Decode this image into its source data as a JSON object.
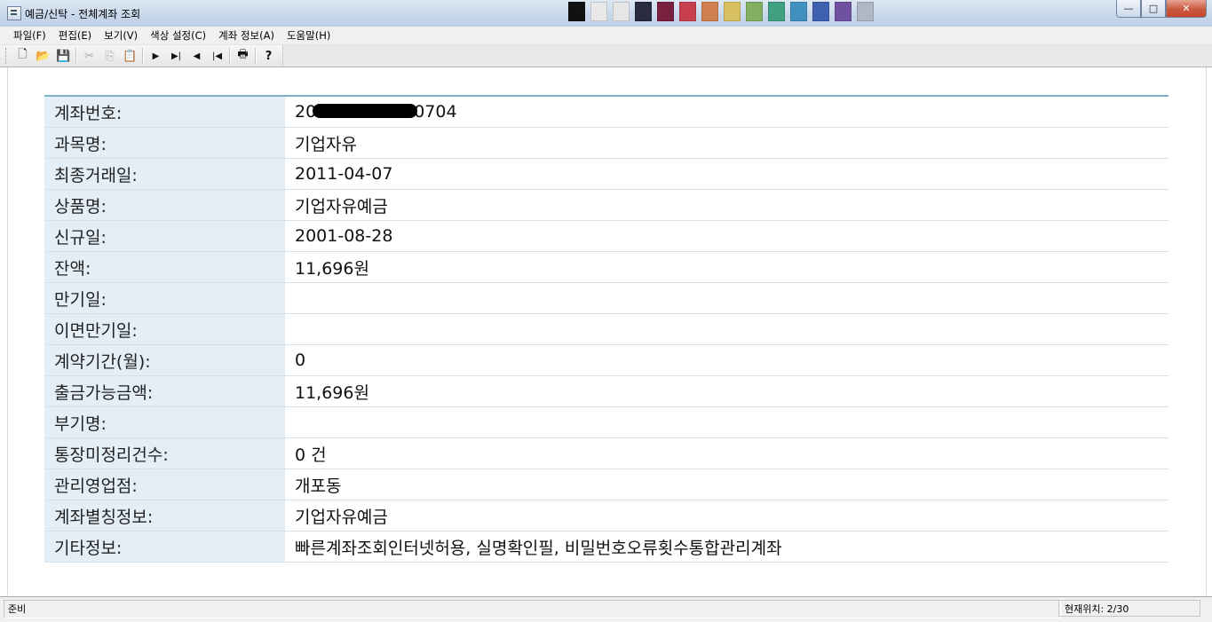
{
  "window": {
    "title": "예금/신탁 - 전체계좌 조회",
    "controls": {
      "minimize": "—",
      "maximize": "□",
      "close": "✕"
    }
  },
  "menu": [
    "파일(F)",
    "편집(E)",
    "보기(V)",
    "색상 설정(C)",
    "계좌 정보(A)",
    "도움말(H)"
  ],
  "toolbar": {
    "buttons": [
      {
        "name": "new-file-icon",
        "glyph": "🗋",
        "enabled": true
      },
      {
        "name": "open-folder-icon",
        "glyph": "📂",
        "enabled": true
      },
      {
        "name": "save-icon",
        "glyph": "💾",
        "enabled": true
      },
      {
        "name": "cut-icon",
        "glyph": "✂",
        "enabled": false
      },
      {
        "name": "copy-icon",
        "glyph": "⎘",
        "enabled": false
      },
      {
        "name": "paste-icon",
        "glyph": "📋",
        "enabled": false
      },
      {
        "name": "next-icon",
        "glyph": "▶",
        "enabled": true
      },
      {
        "name": "last-icon",
        "glyph": "▶|",
        "enabled": true
      },
      {
        "name": "previous-icon",
        "glyph": "◀",
        "enabled": true
      },
      {
        "name": "first-icon",
        "glyph": "|◀",
        "enabled": true
      },
      {
        "name": "print-icon",
        "glyph": "🖶",
        "enabled": true
      },
      {
        "name": "help-icon",
        "glyph": "?",
        "enabled": true
      }
    ]
  },
  "account": {
    "number_prefix": "20",
    "number_suffix": "0704",
    "rows": [
      {
        "label": "계좌번호:",
        "value": ""
      },
      {
        "label": "과목명:",
        "value": "기업자유"
      },
      {
        "label": "최종거래일:",
        "value": "2011-04-07"
      },
      {
        "label": "상품명:",
        "value": "기업자유예금"
      },
      {
        "label": "신규일:",
        "value": "2001-08-28"
      },
      {
        "label": "잔액:",
        "value": "11,696원"
      },
      {
        "label": "만기일:",
        "value": ""
      },
      {
        "label": "이면만기일:",
        "value": ""
      },
      {
        "label": "계약기간(월):",
        "value": "0"
      },
      {
        "label": "출금가능금액:",
        "value": "11,696원"
      },
      {
        "label": "부기명:",
        "value": ""
      },
      {
        "label": "통장미정리건수:",
        "value": "0 건"
      },
      {
        "label": "관리영업점:",
        "value": "개포동"
      },
      {
        "label": "계좌별칭정보:",
        "value": "기업자유예금"
      },
      {
        "label": "기타정보:",
        "value": "빠른계좌조회인터넷허용, 실명확인필, 비밀번호오류횟수통합관리계좌"
      }
    ]
  },
  "status": {
    "left": "준비",
    "right": "현재위치: 2/30"
  }
}
